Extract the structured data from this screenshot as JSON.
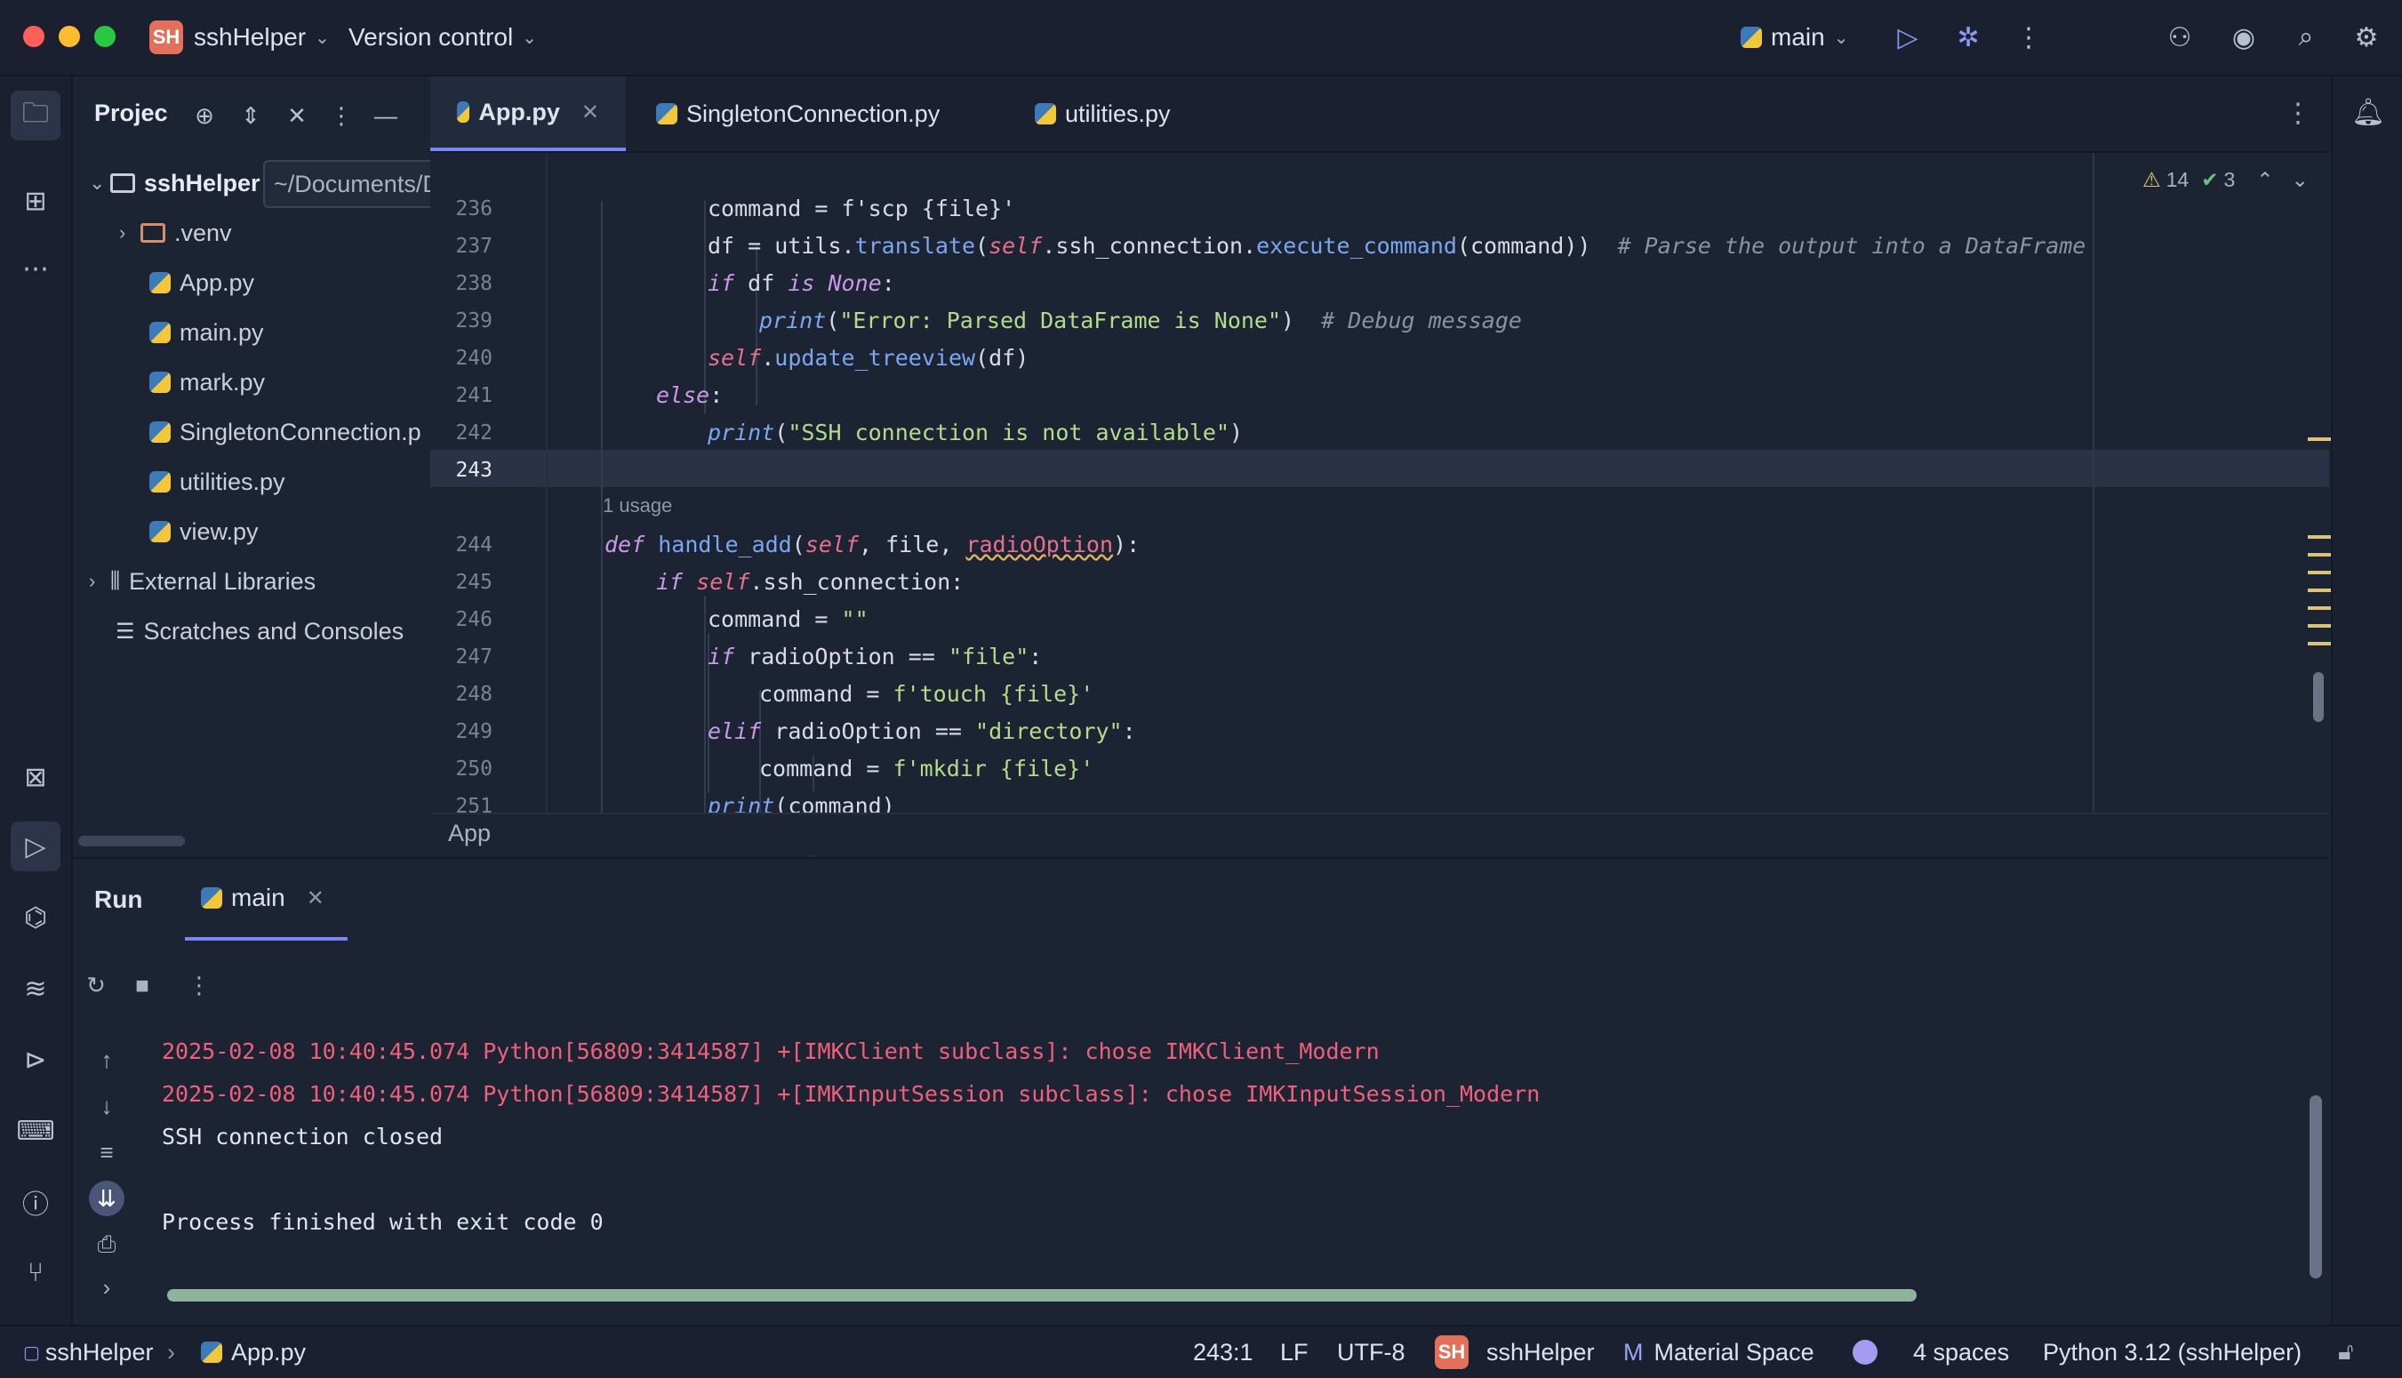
{
  "titlebar": {
    "project_initials": "SH",
    "project_name": "sshHelper",
    "vcs_label": "Version control",
    "run_config": "main"
  },
  "project_panel": {
    "title": "Projec",
    "root_name": "sshHelper",
    "root_path": "~/Documents/DevFolder/Python/Backend/led_backend_less_security/sshHelper",
    "items": [
      {
        "label": ".venv",
        "kind": "folder"
      },
      {
        "label": "App.py",
        "kind": "python"
      },
      {
        "label": "main.py",
        "kind": "python"
      },
      {
        "label": "mark.py",
        "kind": "python"
      },
      {
        "label": "SingletonConnection.p",
        "kind": "python"
      },
      {
        "label": "utilities.py",
        "kind": "python"
      },
      {
        "label": "view.py",
        "kind": "python"
      }
    ],
    "external_libraries": "External Libraries",
    "scratches": "Scratches and Consoles"
  },
  "editor": {
    "tabs": [
      {
        "label": "App.py",
        "active": true
      },
      {
        "label": "SingletonConnection.py",
        "active": false
      },
      {
        "label": "utilities.py",
        "active": false
      }
    ],
    "inspections": {
      "warnings": "14",
      "ok": "3"
    },
    "usage_hint": "1 usage",
    "footer_crumb": "App",
    "line_numbers": [
      "236",
      "237",
      "238",
      "239",
      "240",
      "241",
      "242",
      "243",
      "244",
      "245",
      "246",
      "247",
      "248",
      "249",
      "250",
      "251"
    ],
    "current_line": "243"
  },
  "run_panel": {
    "title": "Run",
    "tab_label": "main",
    "lines": [
      {
        "text": "2025-02-08 10:40:45.074 Python[56809:3414587] +[IMKClient subclass]: chose IMKClient_Modern",
        "kind": "err"
      },
      {
        "text": "2025-02-08 10:40:45.074 Python[56809:3414587] +[IMKInputSession subclass]: chose IMKInputSession_Modern",
        "kind": "err"
      },
      {
        "text": "SSH connection closed",
        "kind": "out"
      },
      {
        "text": "Process finished with exit code 0",
        "kind": "out"
      }
    ]
  },
  "statusbar": {
    "project": "sshHelper",
    "file": "App.py",
    "position": "243:1",
    "line_sep": "LF",
    "encoding": "UTF-8",
    "project_initials": "SH",
    "project_name": "sshHelper",
    "theme": "Material Space",
    "indent": "4 spaces",
    "interpreter": "Python 3.12 (sshHelper)"
  },
  "colors": {
    "background": "#1c2333",
    "accent": "#7a86f4",
    "error_text": "#f0607a",
    "badge": "#e2705a"
  }
}
